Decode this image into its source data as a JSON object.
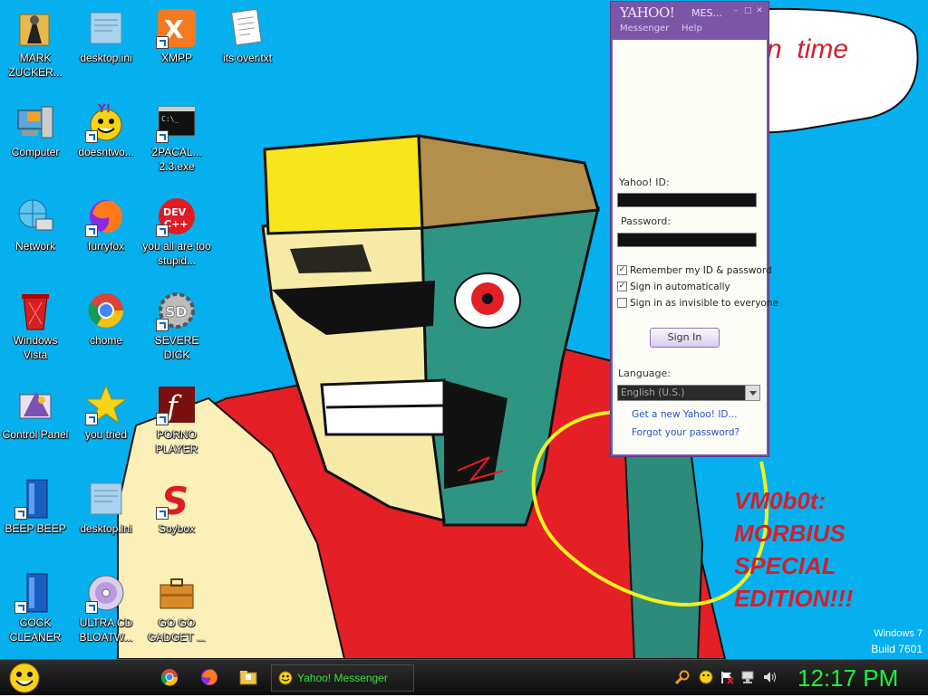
{
  "desktop": {
    "icons": [
      {
        "label": "MARK ZUCKER..."
      },
      {
        "label": "desktop.ini"
      },
      {
        "label": "XMPP"
      },
      {
        "label": "its over.txt"
      },
      {
        "label": "Computer"
      },
      {
        "label": "doesntwo..."
      },
      {
        "label": "2PACAL... 2.3.exe"
      },
      {
        "label": "Network"
      },
      {
        "label": "furryfox"
      },
      {
        "label": "you all are too stupid..."
      },
      {
        "label": "Windows Vista"
      },
      {
        "label": "chome"
      },
      {
        "label": "SEVERE DICK"
      },
      {
        "label": "Control Panel"
      },
      {
        "label": "you tried"
      },
      {
        "label": "PORNO PLAYER"
      },
      {
        "label": "BEEP BEEP"
      },
      {
        "label": "desktop.ini"
      },
      {
        "label": "Soybox"
      },
      {
        "label": "COCK CLEANER"
      },
      {
        "label": "ULTRA CD BLOATW..."
      },
      {
        "label": "GO GO GADGET ..."
      }
    ],
    "wallpaper_text": {
      "bubble": "n  time",
      "caption_lines": [
        "VM0b0t:",
        "MORBIUS",
        "SPECIAL",
        "EDITION!!!"
      ]
    },
    "watermark": {
      "line1": "Windows 7",
      "line2": "Build 7601"
    }
  },
  "messenger": {
    "brand": "YAHOO!",
    "title": "MES...",
    "menu": [
      "Messenger",
      "Help"
    ],
    "yahoo_id_label": "Yahoo! ID:",
    "password_label": "Password:",
    "remember_label": "Remember my ID & password",
    "auto_signin_label": "Sign in automatically",
    "invisible_label": "Sign in as invisible to everyone",
    "remember_checked": true,
    "auto_checked": true,
    "invisible_checked": false,
    "signin_button": "Sign In",
    "language_label": "Language:",
    "language_value": "English (U.S.)",
    "link_new_id": "Get a new Yahoo! ID...",
    "link_forgot": "Forgot your password?"
  },
  "taskbar": {
    "task_label": "Yahoo! Messenger",
    "clock": "12:17 PM"
  },
  "colors": {
    "desktop_bg": "#06b0ee",
    "messenger_purple": "#7b56a6",
    "clock_green": "#1cf23c",
    "task_text": "#37e23a"
  }
}
